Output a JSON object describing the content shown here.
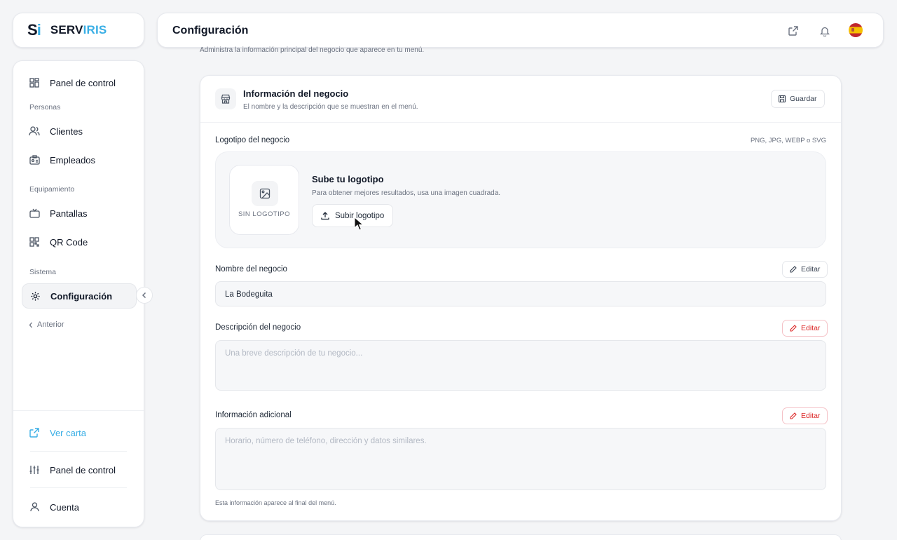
{
  "brand": {
    "mark_s": "S",
    "mark_i": "i",
    "name_a": "SERV",
    "name_b": "IRIS"
  },
  "sidebar": {
    "items": [
      {
        "label": "Panel de control",
        "icon": "dashboard-icon"
      },
      {
        "label": "Clientes",
        "icon": "users-icon"
      },
      {
        "label": "Empleados",
        "icon": "id-badge-icon"
      },
      {
        "label": "Pantallas",
        "icon": "tv-icon"
      },
      {
        "label": "QR Code",
        "icon": "qr-icon"
      },
      {
        "label": "Configuración",
        "icon": "gear-icon",
        "active": true
      }
    ],
    "sections": [
      "Personas",
      "Equipamiento",
      "Sistema"
    ],
    "prev_label": "Anterior",
    "footer": [
      {
        "label": "Ver carta",
        "icon": "external-link-icon"
      },
      {
        "label": "Panel de control",
        "icon": "sliders-icon"
      },
      {
        "label": "Cuenta",
        "icon": "user-icon"
      }
    ]
  },
  "header": {
    "title": "Configuración"
  },
  "page": {
    "subtitle": "Administra la información principal del negocio que aparece en tu menú."
  },
  "card": {
    "title": "Información del negocio",
    "description": "El nombre y la descripción que se muestran en el menú.",
    "save_label": "Guardar",
    "logo": {
      "label": "Logotipo del negocio",
      "formats": "PNG, JPG, WEBP o SVG",
      "empty_label": "SIN LOGOTIPO",
      "title": "Sube tu logotipo",
      "description": "Para obtener mejores resultados, usa una imagen cuadrada.",
      "button": "Subir logotipo"
    },
    "name": {
      "label": "Nombre del negocio",
      "value": "La Bodeguita",
      "edit": "Editar"
    },
    "description_field": {
      "label": "Descripción del negocio",
      "placeholder": "Una breve descripción de tu negocio...",
      "edit": "Editar"
    },
    "extra": {
      "label": "Información adicional",
      "placeholder": "Horario, número de teléfono, dirección y datos similares.",
      "edit": "Editar",
      "note": "Esta información aparece al final del menú."
    }
  },
  "colors": {
    "accent": "#38aee5",
    "danger": "#dc2626"
  }
}
